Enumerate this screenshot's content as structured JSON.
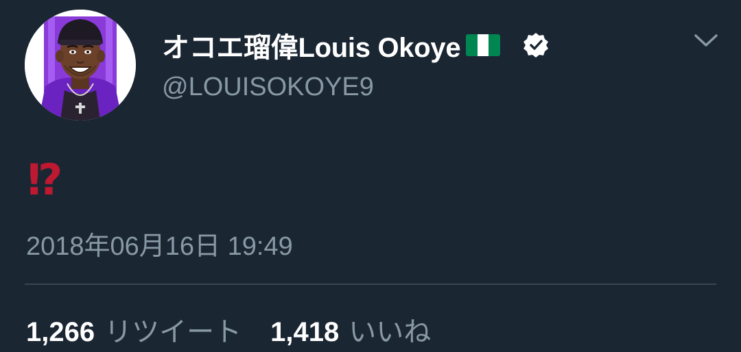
{
  "user": {
    "display_name": "オコエ瑠偉Louis Okoye",
    "handle": "@LOUISOKOYE9",
    "flag_icon": "nigeria-flag-icon",
    "verified_icon": "verified-badge-icon",
    "avatar_icon": "avatar-cartoon-portrait"
  },
  "tweet": {
    "text": "⁉",
    "text_color": "#be1931",
    "timestamp": "2018年06月16日 19:49"
  },
  "stats": {
    "retweet_count": "1,266",
    "retweet_label": "リツイート",
    "like_count": "1,418",
    "like_label": "いいね"
  },
  "menu": {
    "chevron_icon": "chevron-down-icon"
  },
  "colors": {
    "background": "#1b2633",
    "primary_text": "#ffffff",
    "secondary_text": "#8899a6",
    "divider": "#38444d",
    "flag_green": "#008751",
    "avatar_purple": "#7b2fd4"
  }
}
